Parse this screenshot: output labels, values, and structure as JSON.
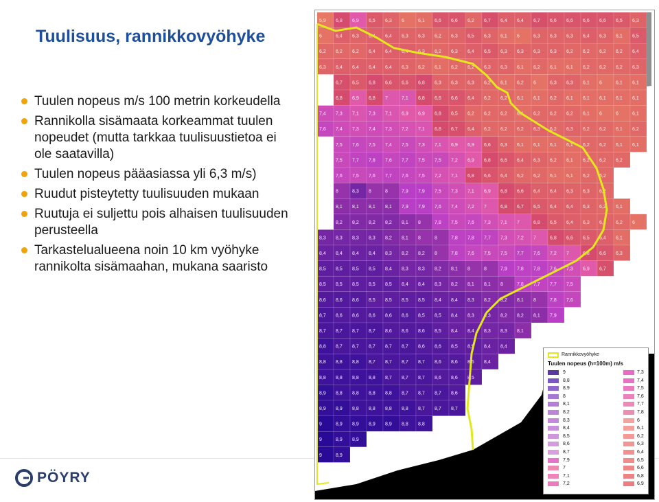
{
  "title": "Tuulisuus, rannikkovyöhyke",
  "bullets": [
    "Tuulen nopeus m/s 100 metrin korkeudella",
    "Rannikolla sisämaata korkeammat tuulen nopeudet (mutta tarkkaa tuulisuustietoa ei ole saatavilla)",
    "Tuulen nopeus pääasiassa yli 6,3 m/s)",
    "Ruudut pisteytetty tuulisuuden mukaan",
    "Ruutuja ei suljettu pois alhaisen tuulisuuden perusteella",
    "Tarkastelualueena noin 10 km vyöhyke rannikolta sisämaahan, mukana saaristo"
  ],
  "logo": {
    "text": "PÖYRY",
    "icon": "poyry-logo-icon"
  },
  "map": {
    "legend": {
      "shore_label": "Rannikkovyöhyke",
      "title": "Tuulen nopeus (h=100m) m/s",
      "left_classes": [
        {
          "label": "9",
          "color": "#5a3aa0"
        },
        {
          "label": "8,8",
          "color": "#7b56c2"
        },
        {
          "label": "8,9",
          "color": "#8f66cc"
        },
        {
          "label": "8",
          "color": "#a777d4"
        },
        {
          "label": "8,1",
          "color": "#b47ed8"
        },
        {
          "label": "8,2",
          "color": "#bd85da"
        },
        {
          "label": "8,3",
          "color": "#c48ad9"
        },
        {
          "label": "8,4",
          "color": "#c98fdb"
        },
        {
          "label": "8,5",
          "color": "#cf96dc"
        },
        {
          "label": "8,6",
          "color": "#d49bde"
        },
        {
          "label": "8,7",
          "color": "#d9a0de"
        },
        {
          "label": "7,9",
          "color": "#e374c8"
        },
        {
          "label": "7",
          "color": "#ee8ab2"
        },
        {
          "label": "7,1",
          "color": "#ec83b9"
        },
        {
          "label": "7,2",
          "color": "#ea7cbe"
        }
      ],
      "right_classes": [
        {
          "label": "7,3",
          "color": "#e86cc4"
        },
        {
          "label": "7,4",
          "color": "#e872c2"
        },
        {
          "label": "7,5",
          "color": "#ea7abf"
        },
        {
          "label": "7,6",
          "color": "#eb80bb"
        },
        {
          "label": "7,7",
          "color": "#ed87b7"
        },
        {
          "label": "7,8",
          "color": "#ee8db2"
        },
        {
          "label": "6",
          "color": "#f4a3a0"
        },
        {
          "label": "6,1",
          "color": "#f39f9c"
        },
        {
          "label": "6,2",
          "color": "#f29a98"
        },
        {
          "label": "6,3",
          "color": "#f19694"
        },
        {
          "label": "6,4",
          "color": "#f09190"
        },
        {
          "label": "6,5",
          "color": "#ef8c8c"
        },
        {
          "label": "6,6",
          "color": "#ee8788"
        },
        {
          "label": "6,8",
          "color": "#ec8284"
        },
        {
          "label": "6,9",
          "color": "#eb7c80"
        }
      ]
    },
    "grid_rows": [
      [
        "5,9",
        "6,8",
        "6,9",
        "6,5",
        "6,3",
        "6",
        "6,1",
        "6,6",
        "6,6",
        "6,2",
        "6,7",
        "6,4",
        "6,4",
        "6,7",
        "6,6",
        "6,6",
        "6,6",
        "6,6",
        "6,5",
        "6,3"
      ],
      [
        "6",
        "6,4",
        "6,3",
        "6,4",
        "6,4",
        "6,3",
        "6,3",
        "6,2",
        "6,3",
        "6,5",
        "6,3",
        "6,1",
        "6",
        "6,3",
        "6,3",
        "6,3",
        "6,4",
        "6,3",
        "6,1",
        "6,5"
      ],
      [
        "6,2",
        "6,2",
        "6,2",
        "6,4",
        "6,4",
        "6,4",
        "6,3",
        "6,2",
        "6,3",
        "6,4",
        "6,5",
        "6,3",
        "6,3",
        "6,3",
        "6,3",
        "6,2",
        "6,2",
        "6,2",
        "6,2",
        "6,4"
      ],
      [
        "6,3",
        "6,4",
        "6,4",
        "6,4",
        "6,4",
        "6,3",
        "6,2",
        "6,1",
        "6,2",
        "6,2",
        "6,3",
        "6,3",
        "6,1",
        "6,2",
        "6,1",
        "6,1",
        "6,2",
        "6,2",
        "6,2",
        "6,3"
      ],
      [
        "",
        "6,7",
        "6,5",
        "6,8",
        "6,6",
        "6,6",
        "6,8",
        "6,3",
        "6,3",
        "6,3",
        "6,2",
        "6,1",
        "6,2",
        "6",
        "6,3",
        "6,3",
        "6,1",
        "6",
        "6,1",
        "6,1"
      ],
      [
        "",
        "6,8",
        "6,9",
        "6,8",
        "7",
        "7,1",
        "6,8",
        "6,6",
        "6,6",
        "6,4",
        "6,2",
        "6,2",
        "6,1",
        "6,1",
        "6,2",
        "6,1",
        "6,1",
        "6,1",
        "6,1",
        "6,1"
      ],
      [
        "7,4",
        "7,3",
        "7,1",
        "7,3",
        "7,1",
        "6,9",
        "6,9",
        "6,8",
        "6,5",
        "6,2",
        "6,2",
        "6,2",
        "6,1",
        "6,2",
        "6,2",
        "6,2",
        "6,1",
        "6",
        "6",
        "6,1"
      ],
      [
        "7,6",
        "7,4",
        "7,3",
        "7,4",
        "7,3",
        "7,2",
        "7,1",
        "6,8",
        "6,7",
        "6,4",
        "6,2",
        "6,2",
        "6,2",
        "6,3",
        "6,2",
        "6,3",
        "6,2",
        "6,2",
        "6,1",
        "6,2"
      ],
      [
        "",
        "7,5",
        "7,6",
        "7,5",
        "7,4",
        "7,5",
        "7,3",
        "7,1",
        "6,9",
        "6,9",
        "6,6",
        "6,3",
        "6,1",
        "6,1",
        "6,1",
        "6,1",
        "6,2",
        "6,2",
        "6,1",
        "6,1"
      ],
      [
        "",
        "7,5",
        "7,7",
        "7,8",
        "7,6",
        "7,7",
        "7,5",
        "7,5",
        "7,2",
        "6,9",
        "6,8",
        "6,6",
        "6,4",
        "6,3",
        "6,2",
        "6,1",
        "6,2",
        "6,2",
        "6,2",
        ""
      ],
      [
        "",
        "7,6",
        "7,5",
        "7,6",
        "7,7",
        "7,6",
        "7,5",
        "7,2",
        "7,1",
        "6,8",
        "6,6",
        "6,4",
        "6,2",
        "6,2",
        "6,1",
        "6,1",
        "6,2",
        "6,2",
        "",
        ""
      ],
      [
        "",
        "8",
        "8,3",
        "8",
        "8",
        "7,9",
        "7,9",
        "7,5",
        "7,3",
        "7,1",
        "6,9",
        "6,8",
        "6,6",
        "6,4",
        "6,4",
        "6,3",
        "6,3",
        "6,2",
        "",
        ""
      ],
      [
        "",
        "8,1",
        "8,1",
        "8,1",
        "8,1",
        "7,9",
        "7,9",
        "7,6",
        "7,4",
        "7,2",
        "7",
        "6,8",
        "6,7",
        "6,5",
        "6,4",
        "6,4",
        "6,3",
        "6,2",
        "6,1",
        ""
      ],
      [
        "",
        "8,2",
        "8,2",
        "8,2",
        "8,2",
        "8,1",
        "8",
        "7,8",
        "7,5",
        "7,6",
        "7,3",
        "7,1",
        "7",
        "6,8",
        "6,5",
        "6,4",
        "6,3",
        "6,3",
        "6,2",
        "6"
      ],
      [
        "8,3",
        "8,3",
        "8,3",
        "8,3",
        "8,2",
        "8,1",
        "8",
        "8",
        "7,8",
        "7,8",
        "7,7",
        "7,3",
        "7,2",
        "7",
        "6,8",
        "6,6",
        "6,5",
        "6,4",
        "6,1",
        ""
      ],
      [
        "8,4",
        "8,4",
        "8,4",
        "8,4",
        "8,3",
        "8,2",
        "8,2",
        "8",
        "7,8",
        "7,6",
        "7,5",
        "7,5",
        "7,7",
        "7,6",
        "7,2",
        "7",
        "6,8",
        "6,6",
        "6,3",
        ""
      ],
      [
        "8,5",
        "8,5",
        "8,5",
        "8,5",
        "8,4",
        "8,3",
        "8,3",
        "8,2",
        "8,1",
        "8",
        "8",
        "7,9",
        "7,8",
        "7,8",
        "7,6",
        "7,3",
        "6,9",
        "6,7",
        "",
        ""
      ],
      [
        "8,5",
        "8,5",
        "8,5",
        "8,5",
        "8,5",
        "8,4",
        "8,4",
        "8,3",
        "8,2",
        "8,1",
        "8,1",
        "8",
        "7,8",
        "7,7",
        "7,7",
        "7,5",
        "",
        "",
        "",
        ""
      ],
      [
        "8,6",
        "8,6",
        "8,6",
        "8,5",
        "8,5",
        "8,5",
        "8,5",
        "8,4",
        "8,4",
        "8,3",
        "8,2",
        "8,2",
        "8,1",
        "8",
        "7,8",
        "7,6",
        "",
        "",
        "",
        ""
      ],
      [
        "8,7",
        "8,6",
        "8,6",
        "8,6",
        "8,6",
        "8,6",
        "8,5",
        "8,5",
        "8,4",
        "8,3",
        "8,3",
        "8,2",
        "8,2",
        "8,1",
        "7,9",
        "",
        "",
        "",
        "",
        ""
      ],
      [
        "8,7",
        "8,7",
        "8,7",
        "8,7",
        "8,6",
        "8,6",
        "8,6",
        "8,5",
        "8,4",
        "8,4",
        "8,3",
        "8,3",
        "8,1",
        "",
        "",
        "",
        "",
        "",
        "",
        ""
      ],
      [
        "8,8",
        "8,7",
        "8,7",
        "8,7",
        "8,7",
        "8,7",
        "8,6",
        "8,6",
        "8,5",
        "8,5",
        "8,4",
        "8,4",
        "",
        "",
        "",
        "",
        "",
        "",
        "",
        ""
      ],
      [
        "8,8",
        "8,8",
        "8,8",
        "8,7",
        "8,7",
        "8,7",
        "8,7",
        "8,6",
        "8,6",
        "8,5",
        "8,4",
        "",
        "",
        "",
        "",
        "",
        "",
        "",
        "",
        ""
      ],
      [
        "8,8",
        "8,8",
        "8,8",
        "8,8",
        "8,7",
        "8,7",
        "8,7",
        "8,6",
        "8,6",
        "8,5",
        "",
        "",
        "",
        "",
        "",
        "",
        "",
        "",
        "",
        ""
      ],
      [
        "8,9",
        "8,8",
        "8,8",
        "8,8",
        "8,8",
        "8,7",
        "8,7",
        "8,7",
        "8,6",
        "",
        "",
        "",
        "",
        "",
        "",
        "",
        "",
        "",
        "",
        ""
      ],
      [
        "8,9",
        "8,9",
        "8,8",
        "8,8",
        "8,8",
        "8,8",
        "8,7",
        "8,7",
        "8,7",
        "",
        "",
        "",
        "",
        "",
        "",
        "",
        "",
        "",
        "",
        ""
      ],
      [
        "9",
        "8,9",
        "8,9",
        "8,9",
        "8,9",
        "8,8",
        "8,8",
        "",
        "",
        "",
        "",
        "",
        "",
        "",
        "",
        "",
        "",
        "",
        "",
        ""
      ],
      [
        "9",
        "8,9",
        "8,9",
        "",
        "",
        "",
        "",
        "",
        "",
        "",
        "",
        "",
        "",
        "",
        "",
        "",
        "",
        "",
        "",
        ""
      ],
      [
        "9",
        "8,9",
        "",
        "",
        "",
        "",
        "",
        "",
        "",
        "",
        "",
        "",
        "",
        "",
        "",
        "",
        "",
        "",
        "",
        ""
      ]
    ]
  }
}
